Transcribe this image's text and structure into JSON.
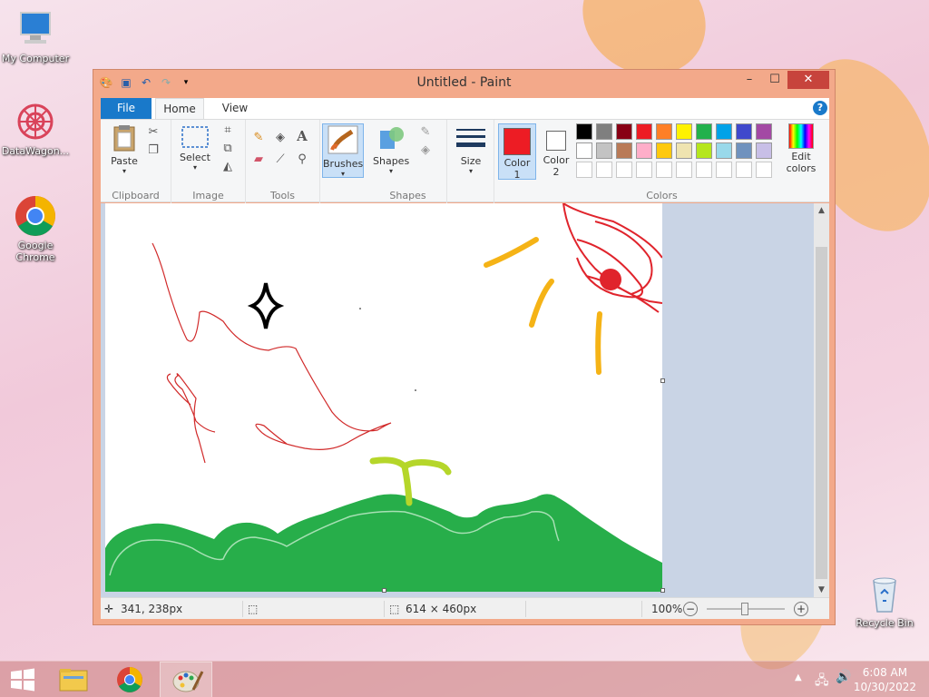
{
  "desktop": {
    "icons": [
      {
        "label": "My Computer",
        "icon": "computer-icon"
      },
      {
        "label": "DataWagon...",
        "icon": "datawagon-icon"
      },
      {
        "label": "Google Chrome",
        "icon": "chrome-icon"
      },
      {
        "label": "Recycle Bin",
        "icon": "recycle-bin-icon"
      }
    ]
  },
  "window": {
    "title": "Untitled - Paint",
    "controls": {
      "minimize": "–",
      "maximize": "☐",
      "close": "✕"
    }
  },
  "tabs": {
    "file": "File",
    "home": "Home",
    "view": "View",
    "help": "?"
  },
  "ribbon": {
    "clipboard": {
      "label": "Clipboard",
      "paste": "Paste"
    },
    "image": {
      "label": "Image",
      "select": "Select"
    },
    "tools": {
      "label": "Tools"
    },
    "brushes": {
      "label": "Brushes"
    },
    "shapes": {
      "label": "Shapes",
      "shapes_button": "Shapes"
    },
    "size": {
      "label": "Size"
    },
    "colors": {
      "label": "Colors",
      "color1": "Color",
      "color1_num": "1",
      "color2": "Color",
      "color2_num": "2",
      "edit": "Edit",
      "edit2": "colors",
      "color1_value": "#ed1c24",
      "color2_value": "#ffffff",
      "palette_row1": [
        "#000000",
        "#7f7f7f",
        "#880015",
        "#ed1c24",
        "#ff7f27",
        "#fff200",
        "#22b14c",
        "#00a2e8",
        "#3f48cc",
        "#a349a4"
      ],
      "palette_row2": [
        "#ffffff",
        "#c3c3c3",
        "#b97a57",
        "#ffaec9",
        "#ffc90e",
        "#efe4b0",
        "#b5e61d",
        "#99d9ea",
        "#7092be",
        "#c8bfe7"
      ]
    }
  },
  "status": {
    "cursor_pos": "341, 238px",
    "canvas_size": "614 × 460px",
    "zoom": "100%"
  },
  "taskbar": {
    "time": "6:08 AM",
    "date": "10/30/2022"
  }
}
